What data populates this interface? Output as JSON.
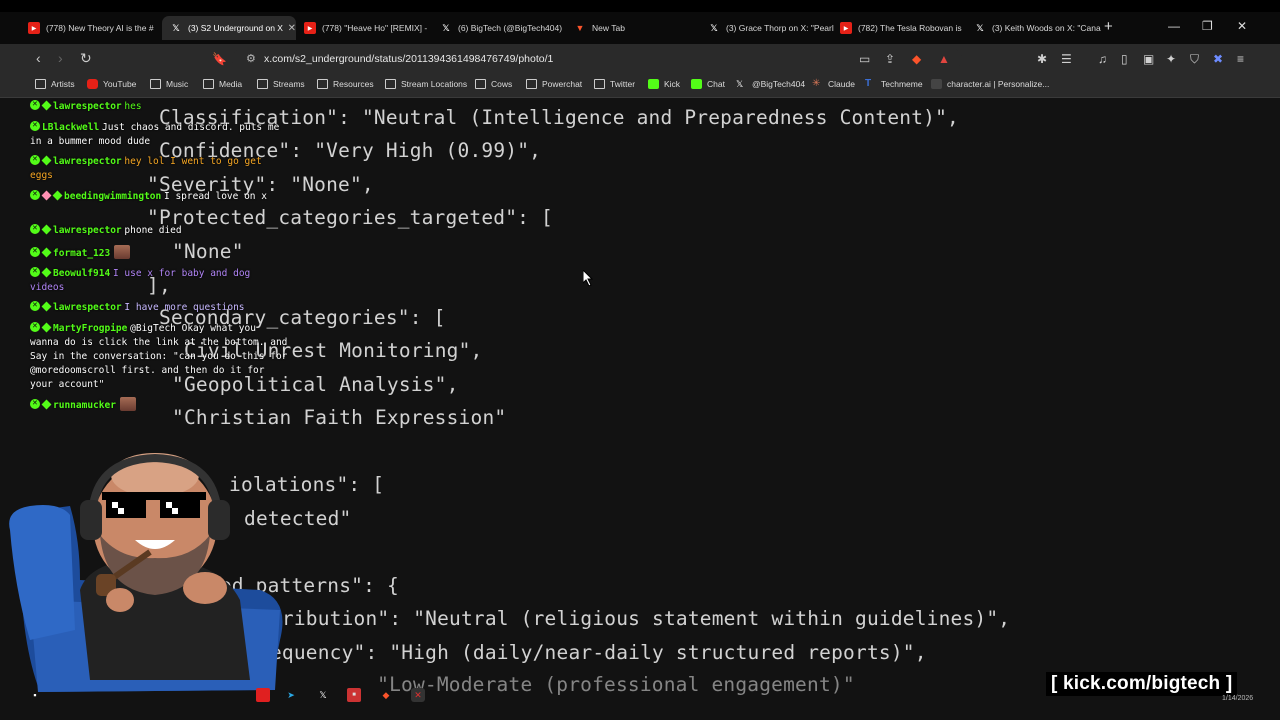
{
  "browser": {
    "tabs": [
      {
        "title": "(778) New Theory AI is the #",
        "icon": "youtube-icon",
        "active": false
      },
      {
        "title": "(3) S2 Underground on X",
        "icon": "x-icon",
        "active": true
      },
      {
        "title": "(778) \"Heave Ho\" [REMIX] -",
        "icon": "youtube-icon",
        "active": false
      },
      {
        "title": "(6) BigTech (@BigTech404)",
        "icon": "x-icon",
        "active": false
      },
      {
        "title": "New Tab",
        "icon": "brave-icon",
        "active": false
      },
      {
        "title": "(3) Grace Thorp on X: \"Pearl",
        "icon": "x-icon",
        "active": false
      },
      {
        "title": "(782) The Tesla Robovan is",
        "icon": "youtube-icon",
        "active": false
      },
      {
        "title": "(3) Keith Woods on X: \"Cana",
        "icon": "x-icon",
        "active": false
      }
    ],
    "new_tab": "+",
    "url": "x.com/s2_underground/status/2011394361498476749/photo/1",
    "bookmarks": [
      {
        "label": "Artists",
        "icon": "folder-icon"
      },
      {
        "label": "YouTube",
        "icon": "youtube-icon"
      },
      {
        "label": "Music",
        "icon": "folder-icon"
      },
      {
        "label": "Media",
        "icon": "folder-icon"
      },
      {
        "label": "Streams",
        "icon": "folder-icon"
      },
      {
        "label": "Resources",
        "icon": "folder-icon"
      },
      {
        "label": "Stream Locations",
        "icon": "folder-icon"
      },
      {
        "label": "Cows",
        "icon": "folder-icon"
      },
      {
        "label": "Powerchat",
        "icon": "folder-icon"
      },
      {
        "label": "Twitter",
        "icon": "folder-icon"
      },
      {
        "label": "Kick",
        "icon": "kick-icon"
      },
      {
        "label": "Chat",
        "icon": "kick-icon"
      },
      {
        "label": "@BigTech404",
        "icon": "x-icon"
      },
      {
        "label": "Claude",
        "icon": "claude-icon"
      },
      {
        "label": "Techmeme",
        "icon": "techmeme-icon"
      },
      {
        "label": "character.ai | Personalize...",
        "icon": "characterai-icon"
      }
    ]
  },
  "code_lines": [
    "Classification\": \"Neutral (Intelligence and Preparedness Content)\",",
    "Confidence\": \"Very High (0.99)\",",
    "\"Severity\": \"None\",",
    "\"Protected_categories_targeted\": [",
    "\"None\"",
    "],",
    "Secondary_categories\": [",
    "Civil Unrest Monitoring\",",
    "\"Geopolitical Analysis\",",
    "\"Christian Faith Expression\"",
    "iolations\": [",
    "detected\"",
    "lated_patterns\": {",
    "ntribution\": \"Neutral (religious statement within guidelines)\",",
    "requency\": \"High (daily/near-daily structured reports)\",",
    "              \"Low-Moderate (professional engagement)\""
  ],
  "chat": [
    {
      "user": "lawrespector",
      "text": "hes",
      "color": "#53fc18",
      "emote": false
    },
    {
      "user": "LBlackwell",
      "text": "Just chaos and discord. puts me in a bummer mood dude",
      "color": "#fefefe",
      "emote": false
    },
    {
      "user": "lawrespector",
      "text": "hey lol I went to go get eggs",
      "color": "#f5a623",
      "emote": false
    },
    {
      "user": "beedingwimmington",
      "text": "I spread love on x",
      "color": "#ffffff",
      "emote": false
    },
    {
      "user": "lawrespector",
      "text": "phone died",
      "color": "#ffffff",
      "emote": false
    },
    {
      "user": "format_123",
      "text": "",
      "color": "#ffffff",
      "emote": true
    },
    {
      "user": "Beowulf914",
      "text": "I use x for baby and dog videos",
      "color": "#b084f5",
      "emote": false
    },
    {
      "user": "lawrespector",
      "text": "I have more questions",
      "color": "#c7b8ff",
      "emote": false
    },
    {
      "user": "MartyFrogpipe",
      "text": "@BigTech Okay what you wanna do is click the link at the bottom. and Say in the conversation: \"can you do this for @moredoomscroll first. and then do it for your account\"",
      "color": "#ffffff",
      "emote": false
    },
    {
      "user": "runnamucker",
      "text": "",
      "color": "#ffffff",
      "emote": true
    }
  ],
  "overlay": {
    "stream_url": "[ kick.com/bigtech ]",
    "date": "1/14/2026"
  },
  "colors": {
    "kick_green": "#53fc18",
    "code_text": "#d2d2d2",
    "background": "#121212"
  }
}
